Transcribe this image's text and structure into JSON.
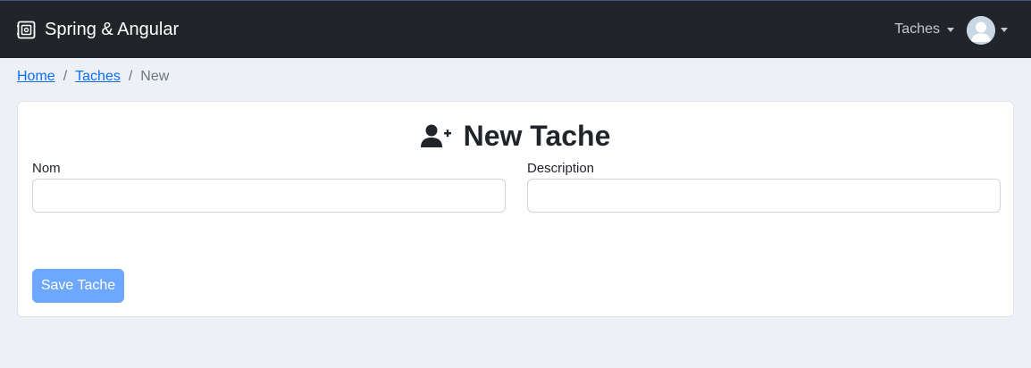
{
  "navbar": {
    "brand_label": "Spring & Angular",
    "brand_icon": "safe-icon",
    "dropdown_label": "Taches",
    "user_avatar": "user-avatar-icon"
  },
  "breadcrumb": {
    "items": [
      {
        "label": "Home"
      },
      {
        "label": "Taches"
      }
    ],
    "separator": "/",
    "current": "New"
  },
  "form": {
    "title": "New Tache",
    "title_icon": "user-plus-icon",
    "fields": [
      {
        "label": "Nom",
        "value": "",
        "placeholder": ""
      },
      {
        "label": "Description",
        "value": "",
        "placeholder": ""
      }
    ],
    "save_label": "Save Tache"
  },
  "colors": {
    "navbar_bg": "#212529",
    "page_bg": "#edf1f5",
    "link": "#0d6efd",
    "primary_disabled": "#6ea8fe"
  }
}
